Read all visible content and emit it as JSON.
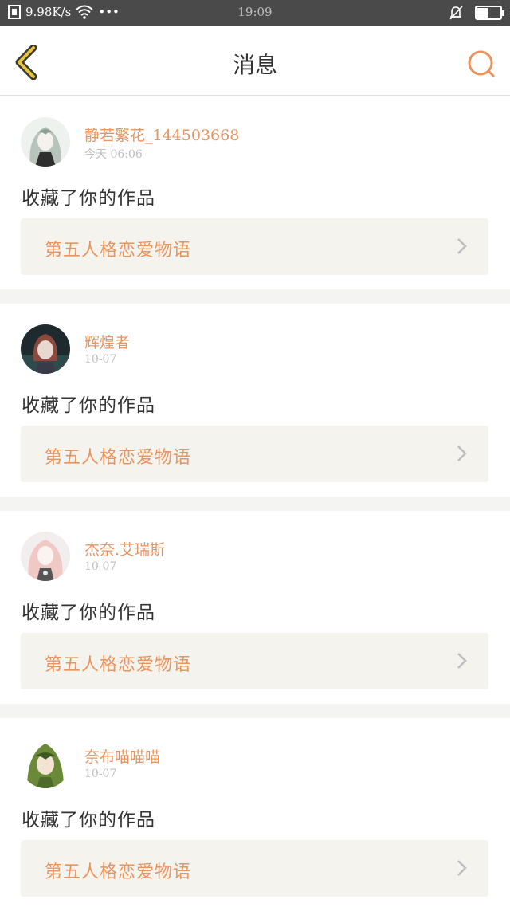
{
  "status_bar": {
    "net_speed": "9.98K/s",
    "dots": "•••",
    "time": "19:09",
    "battery_level": 0.42
  },
  "header": {
    "title": "消息",
    "back_icon": "chevron-left-icon",
    "search_icon": "search-icon",
    "accent_color": "#e8945f",
    "back_color": "#e8c43a"
  },
  "messages": [
    {
      "username": "静若繁花_144503668",
      "time": "今天 06:06",
      "action": "收藏了你的作品",
      "work_title": "第五人格恋爱物语"
    },
    {
      "username": "辉煌者",
      "time": "10-07",
      "action": "收藏了你的作品",
      "work_title": "第五人格恋爱物语"
    },
    {
      "username": "杰奈.艾瑞斯",
      "time": "10-07",
      "action": "收藏了你的作品",
      "work_title": "第五人格恋爱物语"
    },
    {
      "username": "奈布喵喵喵",
      "time": "10-07",
      "action": "收藏了你的作品",
      "work_title": "第五人格恋爱物语"
    }
  ]
}
